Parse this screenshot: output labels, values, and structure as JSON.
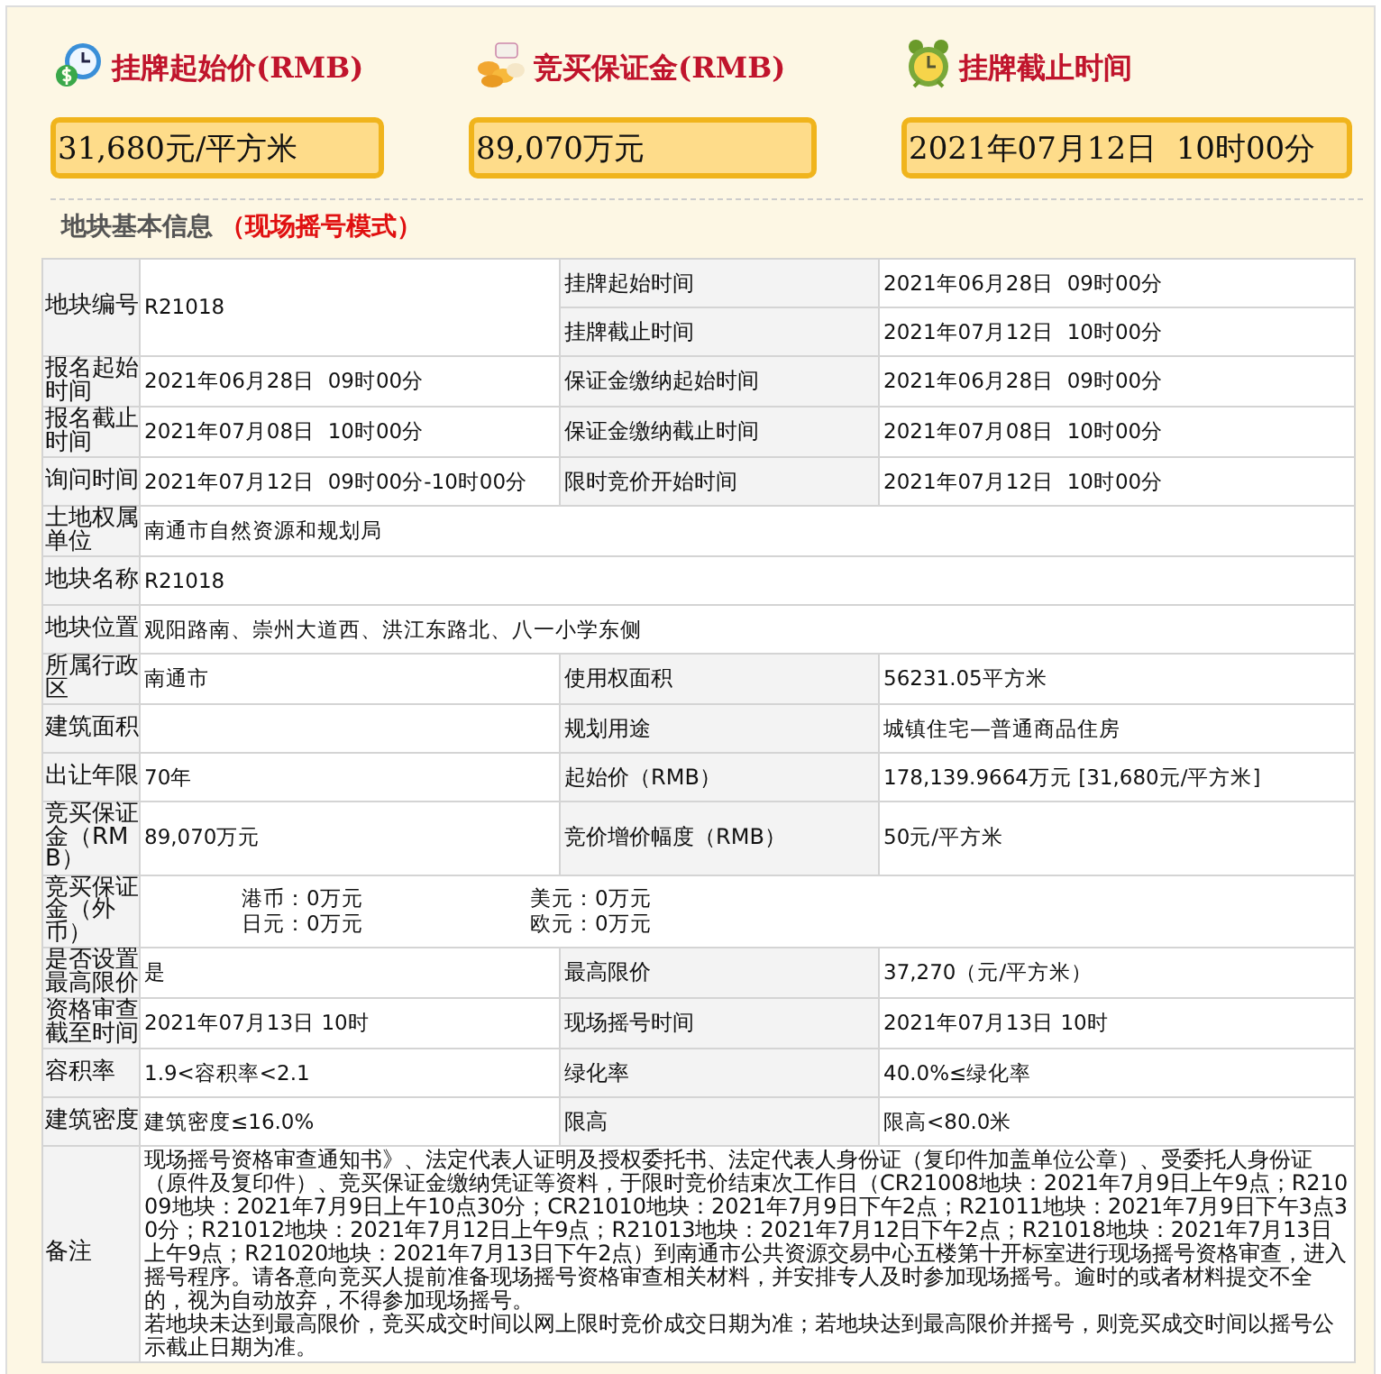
{
  "header": [
    {
      "kind": "clock",
      "label": "挂牌起始价(RMB)",
      "value": "31,680元/平方米"
    },
    {
      "kind": "coins",
      "label": "竞买保证金(RMB)",
      "value": "89,070万元"
    },
    {
      "kind": "alarm",
      "label": "挂牌截止时间",
      "value": "2021年07月12日  10时00分"
    }
  ],
  "section": {
    "title": "地块基本信息",
    "mode": "（现场摇号模式）"
  },
  "table": {
    "rows": [
      {
        "kind": "double",
        "label": "地块编号",
        "value": "R21018",
        "sub": [
          {
            "label": "挂牌起始时间",
            "value": "2021年06月28日  09时00分"
          },
          {
            "label": "挂牌截止时间",
            "value": "2021年07月12日  10时00分"
          }
        ]
      },
      {
        "kind": "pair",
        "label": "报名起始时间",
        "value": "2021年06月28日  09时00分",
        "label2": "保证金缴纳起始时间",
        "value2": "2021年06月28日  09时00分"
      },
      {
        "kind": "pair",
        "label": "报名截止时间",
        "value": "2021年07月08日  10时00分",
        "label2": "保证金缴纳截止时间",
        "value2": "2021年07月08日  10时00分"
      },
      {
        "kind": "pair",
        "label": "询问时间",
        "value": "2021年07月12日  09时00分-10时00分",
        "label2": "限时竞价开始时间",
        "value2": "2021年07月12日  10时00分"
      },
      {
        "kind": "full",
        "label": "土地权属单位",
        "value": "南通市自然资源和规划局"
      },
      {
        "kind": "full",
        "label": "地块名称",
        "value": "R21018"
      },
      {
        "kind": "full",
        "label": "地块位置",
        "value": "观阳路南、崇州大道西、洪江东路北、八一小学东侧"
      },
      {
        "kind": "pair",
        "label": "所属行政区",
        "value": "南通市",
        "label2": "使用权面积",
        "value2": "56231.05平方米"
      },
      {
        "kind": "pair",
        "label": "建筑面积",
        "label2": "规划用途",
        "value2": "城镇住宅—普通商品住房"
      },
      {
        "kind": "pair",
        "label": "出让年限",
        "value": "70年",
        "label2": "起始价（RMB）",
        "value2": "178,139.9664万元 [31,680元/平方米]"
      },
      {
        "kind": "pair",
        "label": "竞买保证金（RMB）",
        "value": "89,070万元",
        "label2": "竞价增价幅度（RMB）",
        "value2": "50元/平方米"
      },
      {
        "kind": "currency",
        "label": "竞买保证金（外币）",
        "items": [
          "港币：0万元",
          "美元：0万元",
          "日元：0万元",
          "欧元：0万元"
        ]
      },
      {
        "kind": "pair",
        "label": "是否设置最高限价",
        "value": "是",
        "label2": "最高限价",
        "value2": "37,270（元/平方米）"
      },
      {
        "kind": "pair",
        "label": "资格审查截至时间",
        "value": "2021年07月13日 10时",
        "label2": "现场摇号时间",
        "value2": "2021年07月13日 10时"
      },
      {
        "kind": "pair",
        "label": "容积率",
        "value": "1.9<容积率<2.1",
        "label2": "绿化率",
        "value2": "40.0%≤绿化率"
      },
      {
        "kind": "pair",
        "label": "建筑密度",
        "value": "建筑密度≤16.0%",
        "label2": "限高",
        "value2": "限高<80.0米"
      },
      {
        "kind": "note",
        "label": "备注",
        "paragraphs": [
          "现场摇号资格审查通知书》、法定代表人证明及授权委托书、法定代表人身份证（复印件加盖单位公章）、受委托人身份证（原件及复印件）、竞买保证金缴纳凭证等资料，于限时竞价结束次工作日（CR21008地块：2021年7月9日上午9点；R21009地块：2021年7月9日上午10点30分；CR21010地块：2021年7月9日下午2点；R21011地块：2021年7月9日下午3点30分；R21012地块：2021年7月12日上午9点；R21013地块：2021年7月12日下午2点；R21018地块：2021年7月13日上午9点；R21020地块：2021年7月13日下午2点）到南通市公共资源交易中心五楼第十开标室进行现场摇号资格审查，进入摇号程序。请各意向竞买人提前准备现场摇号资格审查相关材料，并安排专人及时参加现场摇号。逾时的或者材料提交不全的，视为自动放弃，不得参加现场摇号。",
          "若地块未达到最高限价，竞买成交时间以网上限时竞价成交日期为准；若地块达到最高限价并摇号，则竞买成交时间以摇号公示截止日期为准。"
        ]
      }
    ]
  }
}
